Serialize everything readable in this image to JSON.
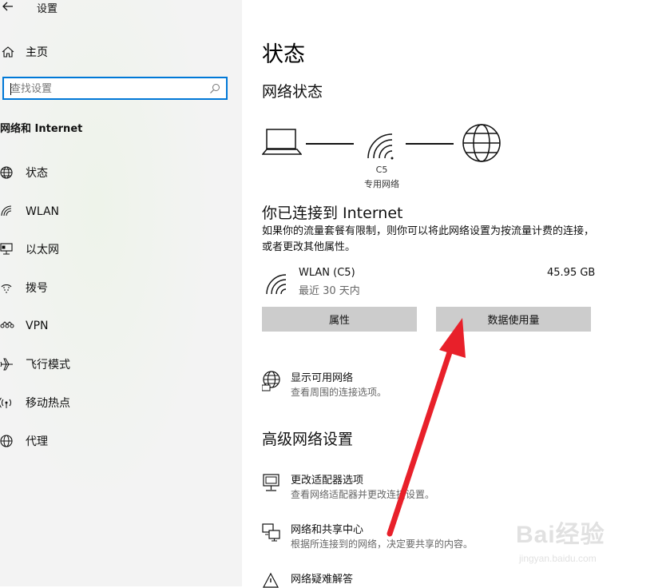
{
  "window": {
    "title": "设置"
  },
  "sidebar": {
    "home_label": "主页",
    "search_placeholder": "查找设置",
    "section_title": "网络和 Internet",
    "items": [
      {
        "label": "状态",
        "icon": "globe-icon"
      },
      {
        "label": "WLAN",
        "icon": "wifi-icon"
      },
      {
        "label": "以太网",
        "icon": "ethernet-icon"
      },
      {
        "label": "拨号",
        "icon": "dialup-icon"
      },
      {
        "label": "VPN",
        "icon": "vpn-icon"
      },
      {
        "label": "飞行模式",
        "icon": "airplane-icon"
      },
      {
        "label": "移动热点",
        "icon": "hotspot-icon"
      },
      {
        "label": "代理",
        "icon": "proxy-globe-icon"
      }
    ]
  },
  "main": {
    "page_title": "状态",
    "network_status_heading": "网络状态",
    "diagram": {
      "network_name": "C5",
      "network_type": "专用网络"
    },
    "connected_heading": "你已连接到 Internet",
    "connected_desc": "如果你的流量套餐有限制，则你可以将此网络设置为按流量计费的连接，或者更改其他属性。",
    "connection": {
      "name": "WLAN (C5)",
      "period": "最近 30 天内",
      "usage": "45.95 GB"
    },
    "buttons": {
      "properties": "属性",
      "data_usage": "数据使用量"
    },
    "show_networks": {
      "title": "显示可用网络",
      "subtitle": "查看周围的连接选项。"
    },
    "advanced_heading": "高级网络设置",
    "advanced_items": [
      {
        "title": "更改适配器选项",
        "subtitle": "查看网络适配器并更改连接设置。"
      },
      {
        "title": "网络和共享中心",
        "subtitle": "根据所连接到的网络，决定要共享的内容。"
      },
      {
        "title": "网络疑难解答",
        "subtitle": ""
      }
    ]
  },
  "watermark": {
    "logo": "Bai经验",
    "url": "jingyan.baidu.com"
  },
  "colors": {
    "accent": "#0078d7",
    "button_bg": "#cccccc",
    "arrow": "#e8202a"
  }
}
